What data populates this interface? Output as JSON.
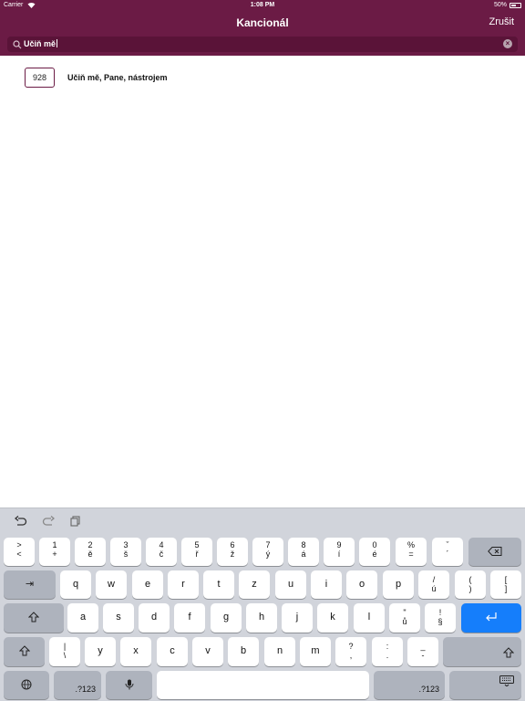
{
  "status_bar": {
    "carrier": "Carrier",
    "wifi_icon": "wifi-icon",
    "time": "1:08 PM",
    "battery": "50%"
  },
  "nav": {
    "title": "Kancionál",
    "cancel": "Zrušit"
  },
  "search": {
    "value": "Učiň mě",
    "icon": "search-icon",
    "clear_icon": "clear-icon"
  },
  "results": [
    {
      "number": "928",
      "title": "Učiň mě, Pane, nástrojem"
    }
  ],
  "keyboard": {
    "toolbar": {
      "undo_icon": "undo-icon",
      "redo_icon": "redo-icon",
      "paste_icon": "paste-icon"
    },
    "row1": [
      {
        "top": ">",
        "bottom": "<"
      },
      {
        "top": "1",
        "bottom": "+"
      },
      {
        "top": "2",
        "bottom": "ě"
      },
      {
        "top": "3",
        "bottom": "š"
      },
      {
        "top": "4",
        "bottom": "č"
      },
      {
        "top": "5",
        "bottom": "ř"
      },
      {
        "top": "6",
        "bottom": "ž"
      },
      {
        "top": "7",
        "bottom": "ý"
      },
      {
        "top": "8",
        "bottom": "á"
      },
      {
        "top": "9",
        "bottom": "í"
      },
      {
        "top": "0",
        "bottom": "é"
      },
      {
        "top": "%",
        "bottom": "="
      },
      {
        "top": "ˇ",
        "bottom": "´"
      }
    ],
    "row2": [
      {
        "label": "q"
      },
      {
        "label": "w"
      },
      {
        "label": "e"
      },
      {
        "label": "r"
      },
      {
        "label": "t"
      },
      {
        "label": "z"
      },
      {
        "label": "u"
      },
      {
        "label": "i"
      },
      {
        "label": "o"
      },
      {
        "label": "p"
      },
      {
        "top": "/",
        "bottom": "ú"
      },
      {
        "top": "(",
        "bottom": ")"
      },
      {
        "top": "[",
        "bottom": "]"
      }
    ],
    "row3": [
      {
        "label": "a"
      },
      {
        "label": "s"
      },
      {
        "label": "d"
      },
      {
        "label": "f"
      },
      {
        "label": "g"
      },
      {
        "label": "h"
      },
      {
        "label": "j"
      },
      {
        "label": "k"
      },
      {
        "label": "l"
      },
      {
        "top": "\"",
        "bottom": "ů"
      },
      {
        "top": "!",
        "bottom": "§"
      }
    ],
    "row4": [
      {
        "top": "|",
        "bottom": "\\"
      },
      {
        "label": "y"
      },
      {
        "label": "x"
      },
      {
        "label": "c"
      },
      {
        "label": "v"
      },
      {
        "label": "b"
      },
      {
        "label": "n"
      },
      {
        "label": "m"
      },
      {
        "top": "?",
        "bottom": ","
      },
      {
        "top": ":",
        "bottom": "."
      },
      {
        "top": "_",
        "bottom": "-"
      }
    ],
    "labels": {
      "numbers_left": ".?123",
      "numbers_right": ".?123"
    },
    "icons": {
      "delete": "delete-icon",
      "tab": "tab-icon",
      "caps": "caps-lock-icon",
      "enter": "return-icon",
      "shift": "shift-icon",
      "globe": "globe-icon",
      "mic": "microphone-icon",
      "dismiss": "keyboard-dismiss-icon"
    },
    "colors": {
      "enter_key": "#157efb",
      "keyboard_bg": "#d1d4db"
    }
  },
  "colors": {
    "header_bg": "#6b1b45",
    "accent": "#6b1b45"
  }
}
